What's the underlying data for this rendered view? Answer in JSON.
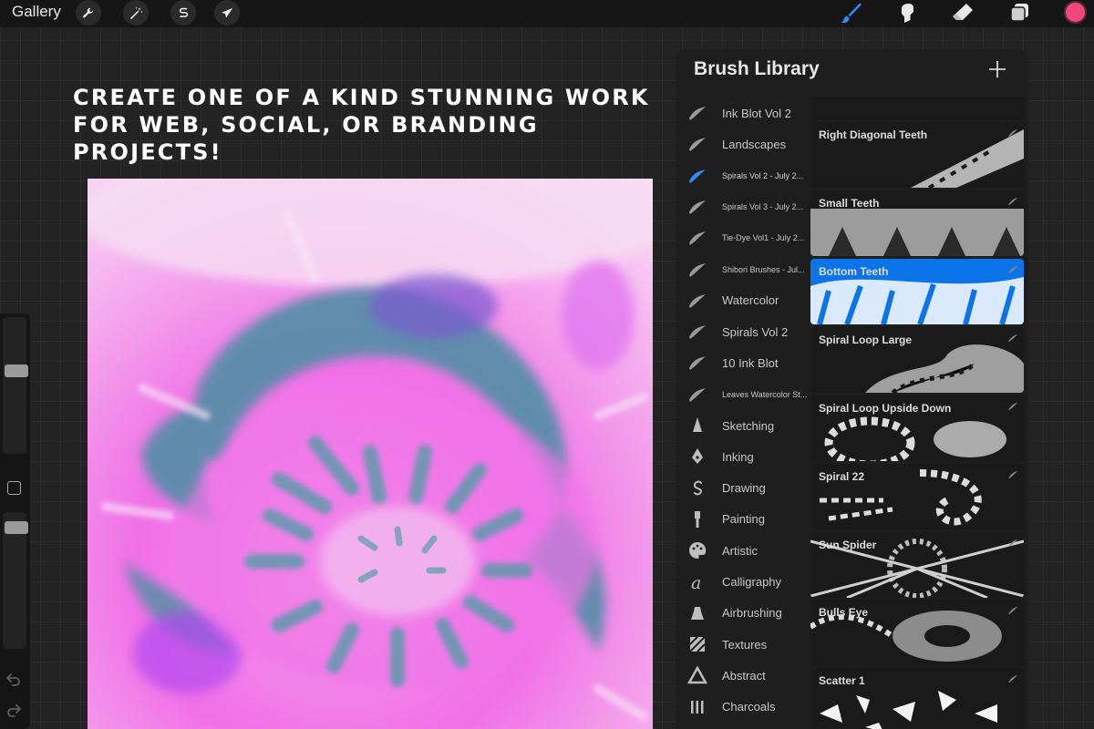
{
  "toolbar": {
    "gallery": "Gallery",
    "left_tools": [
      "wrench-icon",
      "magic-wand-icon",
      "selection-s-icon",
      "transform-arrow-icon"
    ],
    "right_tools": [
      "brush-icon",
      "smudge-icon",
      "eraser-icon",
      "layers-icon"
    ],
    "active_tool": "brush-icon",
    "active_color": "#f0477d",
    "brush_active_color": "#2f8bf5"
  },
  "headline": {
    "line1": "CREATE ONE OF A KIND STUNNING WORK",
    "line2": "FOR WEB, SOCIAL, OR BRANDING PROJECTS!"
  },
  "sidebar": {
    "brush_size_level": 0.4,
    "opacity_level": 0.06
  },
  "library": {
    "title": "Brush Library",
    "sets": [
      {
        "label": "Ink Blot Vol 2",
        "icon": "brush-stroke-icon"
      },
      {
        "label": "Landscapes",
        "icon": "brush-stroke-icon"
      },
      {
        "label": "Spirals Vol 2 - July 2...",
        "icon": "brush-stroke-icon",
        "active": true
      },
      {
        "label": "Spirals Vol 3 - July 2...",
        "icon": "brush-stroke-icon"
      },
      {
        "label": "Tie-Dye Vol1 - July 2...",
        "icon": "brush-stroke-icon"
      },
      {
        "label": "Shibori Brushes - Jul...",
        "icon": "brush-stroke-icon"
      },
      {
        "label": "Watercolor",
        "icon": "brush-stroke-icon"
      },
      {
        "label": "Spirals Vol 2",
        "icon": "brush-stroke-icon"
      },
      {
        "label": "10 Ink Blot",
        "icon": "brush-stroke-icon"
      },
      {
        "label": "Leaves Watercolor St...",
        "icon": "brush-stroke-icon"
      },
      {
        "label": "Sketching",
        "icon": "pencil-tip-icon"
      },
      {
        "label": "Inking",
        "icon": "pen-nib-icon"
      },
      {
        "label": "Drawing",
        "icon": "squiggle-icon"
      },
      {
        "label": "Painting",
        "icon": "paint-brush-icon"
      },
      {
        "label": "Artistic",
        "icon": "palette-icon"
      },
      {
        "label": "Calligraphy",
        "icon": "calligraphy-a-icon"
      },
      {
        "label": "Airbrushing",
        "icon": "airbrush-icon"
      },
      {
        "label": "Textures",
        "icon": "texture-icon"
      },
      {
        "label": "Abstract",
        "icon": "triangle-icon"
      },
      {
        "label": "Charcoals",
        "icon": "charcoal-icon"
      }
    ],
    "brushes": [
      {
        "name": ""
      },
      {
        "name": "Right Diagonal Teeth"
      },
      {
        "name": "Small Teeth"
      },
      {
        "name": "Bottom Teeth",
        "selected": true
      },
      {
        "name": "Spiral Loop Large"
      },
      {
        "name": "Spiral Loop Upside Down"
      },
      {
        "name": "Spiral 22"
      },
      {
        "name": "Sun Spider"
      },
      {
        "name": "Bulls Eye"
      },
      {
        "name": "Scatter 1"
      }
    ]
  }
}
